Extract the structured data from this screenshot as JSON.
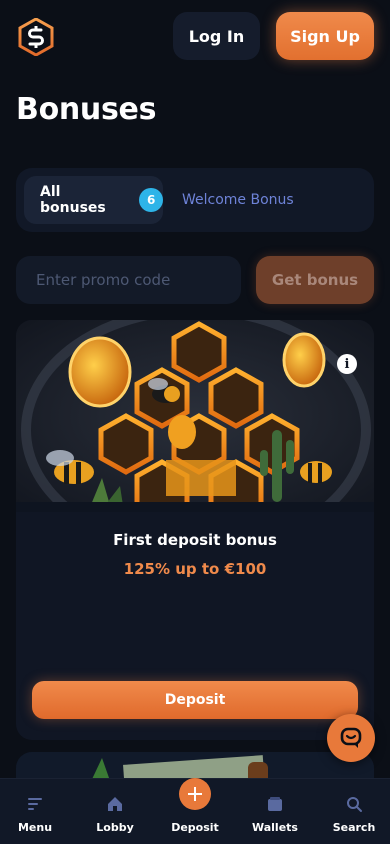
{
  "header": {
    "login_label": "Log In",
    "signup_label": "Sign Up"
  },
  "page_title": "Bonuses",
  "tabs": [
    {
      "label": "All bonuses",
      "badge": "6",
      "active": true
    },
    {
      "label": "Welcome Bonus",
      "active": false
    }
  ],
  "promo": {
    "placeholder": "Enter promo code",
    "button_label": "Get bonus"
  },
  "bonus_card": {
    "title": "First deposit bonus",
    "subtitle": "125% up to €100",
    "button_label": "Deposit",
    "info_glyph": "i"
  },
  "bottom_nav": [
    {
      "label": "Menu",
      "icon": "menu-icon"
    },
    {
      "label": "Lobby",
      "icon": "home-icon"
    },
    {
      "label": "Deposit",
      "icon": "plus-icon"
    },
    {
      "label": "Wallets",
      "icon": "wallet-icon"
    },
    {
      "label": "Search",
      "icon": "search-icon"
    }
  ],
  "colors": {
    "background": "#0b0f17",
    "accent": "#f08a4b",
    "badge": "#2eb4e8",
    "link": "#6e83d8"
  }
}
